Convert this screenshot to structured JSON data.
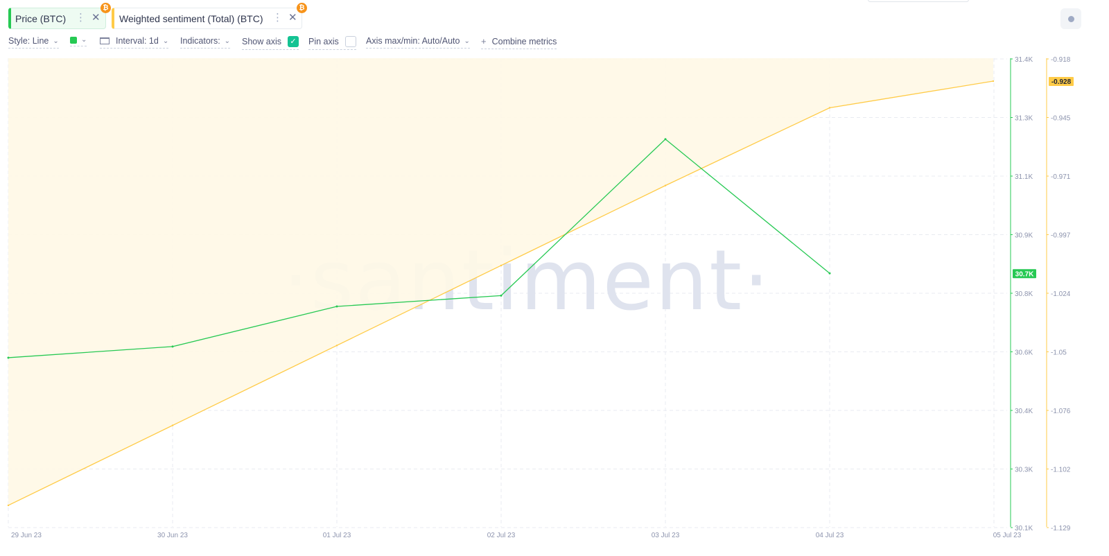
{
  "metric_chips": [
    {
      "label": "Price (BTC)",
      "color": "#26c953",
      "badge": "₿"
    },
    {
      "label": "Weighted sentiment (Total) (BTC)",
      "color": "#ffcb47",
      "badge": "₿"
    }
  ],
  "toolbar": {
    "style_label": "Style: Line",
    "interval_label": "Interval: 1d",
    "indicators_label": "Indicators:",
    "show_axis_label": "Show axis",
    "show_axis_checked": true,
    "pin_axis_label": "Pin axis",
    "pin_axis_checked": false,
    "axis_minmax_label": "Axis max/min: Auto/Auto",
    "combine_label": "Combine metrics"
  },
  "watermark": "·santiment·",
  "chart_data": {
    "type": "line",
    "x": [
      "29 Jun 23",
      "30 Jun 23",
      "01 Jul 23",
      "02 Jul 23",
      "03 Jul 23",
      "04 Jul 23",
      "05 Jul 23"
    ],
    "series": [
      {
        "name": "Price (BTC)",
        "color": "#26c953",
        "axis": "right-inner",
        "values": [
          30380,
          30418,
          30555,
          30592,
          31126,
          30668,
          null
        ],
        "last_value_label": "30.7K"
      },
      {
        "name": "Weighted sentiment (Total) (BTC)",
        "color": "#ffcb47",
        "axis": "right-outer",
        "fill": true,
        "values": [
          -1.119,
          -1.083,
          -1.047,
          -1.011,
          -0.975,
          -0.94,
          -0.928
        ],
        "last_value_label": "-0.928"
      }
    ],
    "y_axes": [
      {
        "id": "right-inner",
        "ticks": [
          "31.4K",
          "31.3K",
          "31.1K",
          "30.9K",
          "30.8K",
          "30.6K",
          "30.4K",
          "30.3K",
          "30.1K"
        ],
        "tick_values": [
          31400,
          31200,
          31000,
          30800,
          30600,
          30400,
          30200,
          30000,
          29800
        ],
        "range": [
          29800,
          31400
        ]
      },
      {
        "id": "right-outer",
        "ticks": [
          "-0.918",
          "-0.945",
          "-0.971",
          "-0.997",
          "-1.024",
          "-1.05",
          "-1.076",
          "-1.102",
          "-1.129"
        ],
        "range": [
          -1.129,
          -0.918
        ]
      }
    ],
    "grid": true
  }
}
